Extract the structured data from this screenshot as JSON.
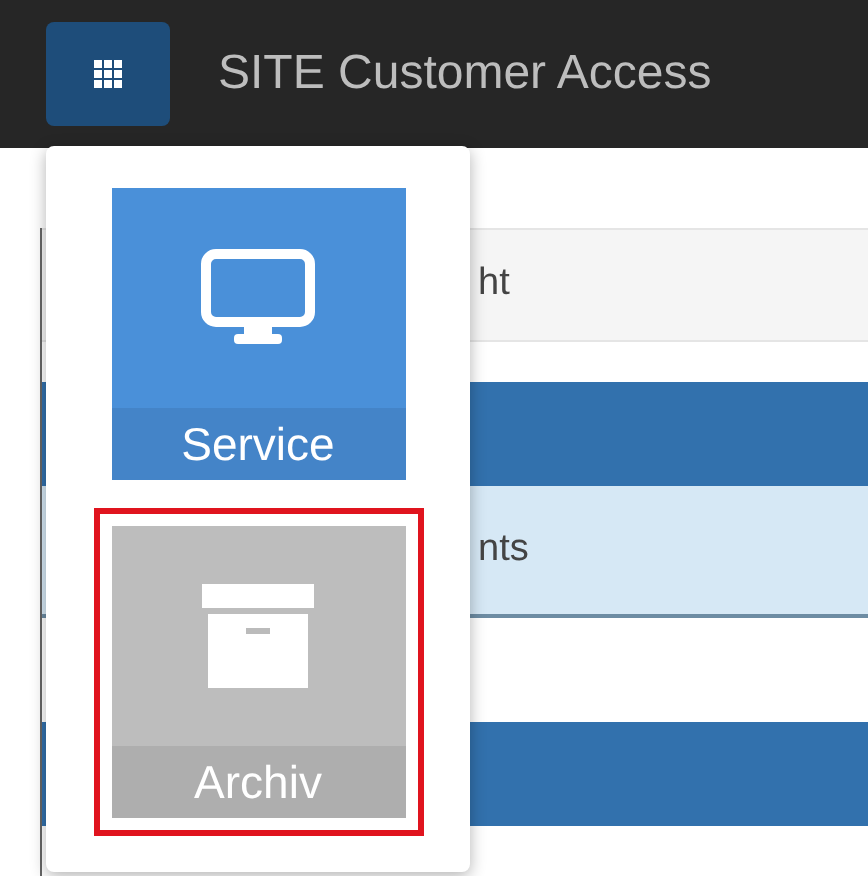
{
  "header": {
    "title": "SITE Customer Access"
  },
  "page_rows": [
    {
      "kind": "gray",
      "text": "ht"
    },
    {
      "kind": "bar"
    },
    {
      "kind": "light",
      "text": "nts"
    },
    {
      "kind": "white"
    },
    {
      "kind": "bar"
    }
  ],
  "app_menu": {
    "items": [
      {
        "label": "Service",
        "kind": "monitor",
        "color": "#4a90d9",
        "selected": false
      },
      {
        "label": "Archiv",
        "kind": "box",
        "color": "#bdbdbd",
        "selected": true
      }
    ]
  }
}
